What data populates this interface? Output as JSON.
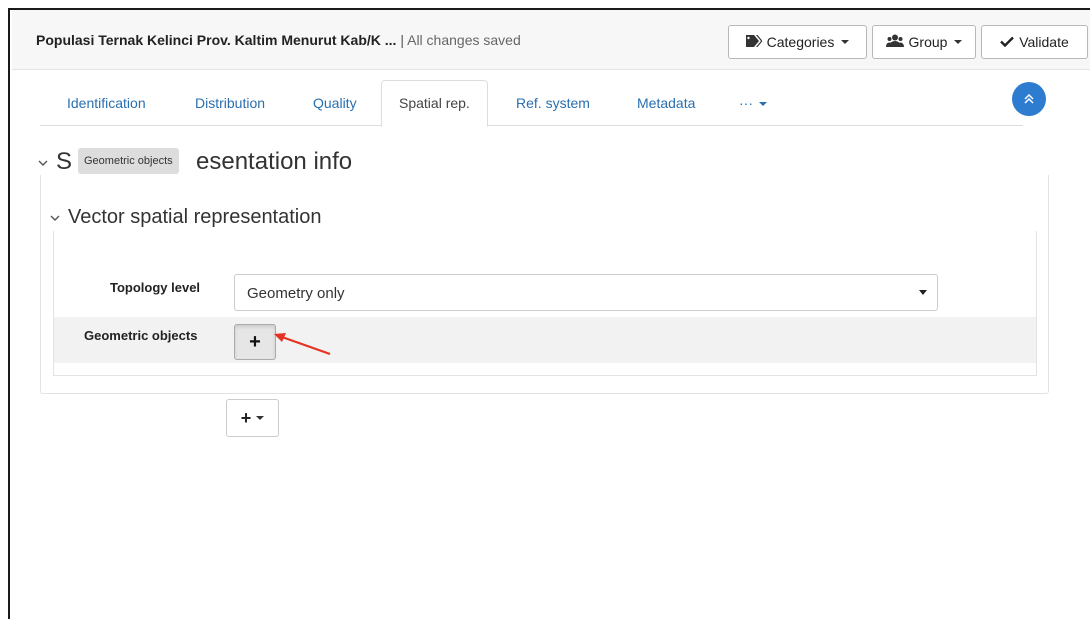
{
  "header": {
    "title": "Populasi Ternak Kelinci Prov. Kaltim Menurut Kab/K ...",
    "separator": "|",
    "status": "All changes saved",
    "buttons": {
      "categories": "Categories",
      "group": "Group",
      "validate": "Validate"
    },
    "icons": {
      "categories": "tags-icon",
      "group": "users-icon",
      "validate": "check-icon"
    }
  },
  "tabs": [
    {
      "label": "Identification"
    },
    {
      "label": "Distribution"
    },
    {
      "label": "Quality"
    },
    {
      "label": "Spatial rep.",
      "active": true
    },
    {
      "label": "Ref. system"
    },
    {
      "label": "Metadata"
    },
    {
      "label": "···"
    }
  ],
  "section": {
    "title_prefix": "S",
    "title_suffix": "esentation info",
    "tooltip": "Geometric objects"
  },
  "subsection": {
    "title": "Vector spatial representation",
    "topology_label": "Topology level",
    "topology_value": "Geometry only",
    "geometric_label": "Geometric objects",
    "add_symbol": "+"
  },
  "footer": {
    "add_symbol": "+"
  },
  "colors": {
    "link": "#2a6fb0",
    "accent": "#2e7ccf",
    "annotation_arrow": "#e53222"
  }
}
